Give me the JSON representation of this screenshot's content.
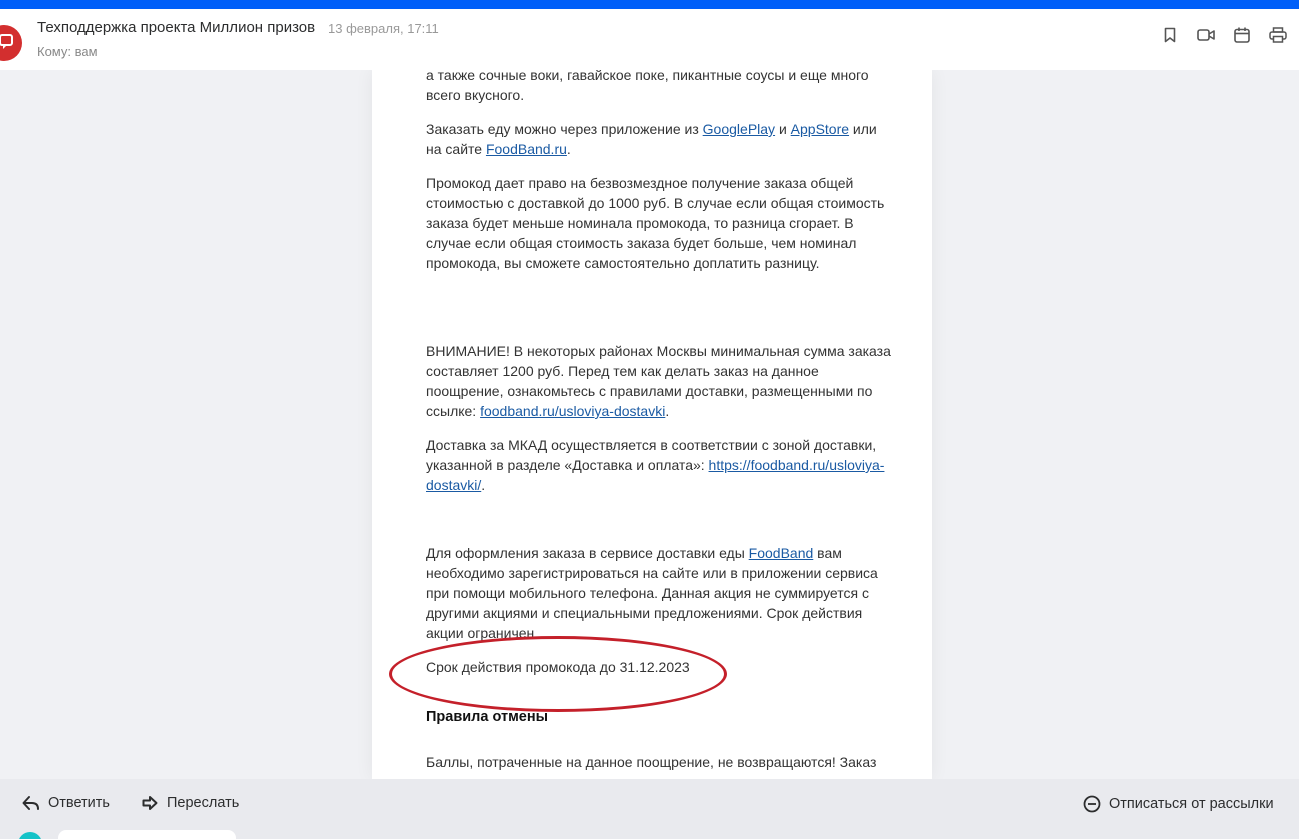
{
  "header": {
    "sender": "Техподдержка проекта Миллион призов",
    "date": "13 февраля, 17:11",
    "recipient": "Кому: вам",
    "icons": [
      "bookmark-icon",
      "video-icon",
      "calendar-icon",
      "print-icon"
    ]
  },
  "body": {
    "p1": "а также сочные воки, гавайское поке, пикантные соусы и еще много всего вкусного.",
    "p2_pre": "Заказать еду можно через приложение из ",
    "p2_link1": "GooglePlay",
    "p2_mid1": " и ",
    "p2_link2": "AppStore",
    "p2_mid2": " или на сайте ",
    "p2_link3": "FoodBand.ru",
    "p2_post": ".",
    "p3": "Промокод дает право на безвозмездное получение заказа общей стоимостью с доставкой до 1000 руб. В случае если общая стоимость заказа будет меньше номинала промокода, то разница сгорает. В случае если общая стоимость заказа будет больше, чем номинал промокода, вы сможете самостоятельно доплатить разницу.",
    "p4_pre": "ВНИМАНИЕ! В некоторых районах Москвы минимальная сумма заказа составляет 1200 руб. Перед тем как делать заказ на данное поощрение, ознакомьтесь с правилами доставки, размещенными по ссылке: ",
    "p4_link": "foodband.ru/usloviya-dostavki",
    "p4_post": ".",
    "p5_pre": "Доставка за МКАД осуществляется в соответствии с зоной доставки, указанной в разделе «Доставка и оплата»: ",
    "p5_link": "https://foodband.ru/usloviya-dostavki/",
    "p5_post": ".",
    "p6_pre": "Для оформления заказа в сервисе доставки еды ",
    "p6_link": "FoodBand",
    "p6_post": " вам необходимо зарегистрироваться на сайте или в приложении сервиса при помощи мобильного телефона. Данная акция не суммируется с другими акциями и специальными предложениями. Срок действия акции ограничен",
    "p7": "Срок действия промокода до 31.12.2023",
    "heading": "Правила отмены",
    "p8": "Баллы, потраченные на данное поощрение, не возвращаются! Заказ"
  },
  "footer": {
    "reply": "Ответить",
    "forward": "Переслать",
    "unsubscribe": "Отписаться от рассылки"
  },
  "colors": {
    "accent": "#005ff9",
    "link": "#1a5aa3",
    "annotation": "#c4202a",
    "avatar": "#d32f2f"
  }
}
